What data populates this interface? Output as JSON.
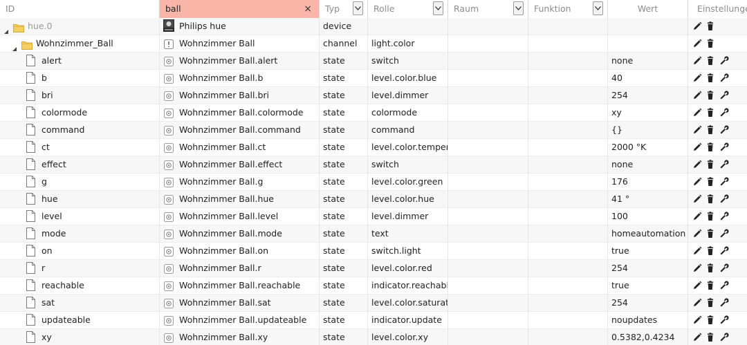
{
  "header": {
    "id_label": "ID",
    "name_filter_value": "ball",
    "typ_label": "Typ",
    "rolle_label": "Rolle",
    "raum_label": "Raum",
    "funktion_label": "Funktion",
    "wert_label": "Wert",
    "settings_label": "Einstellungen",
    "clear_icon": "×"
  },
  "colors": {
    "filter_bg": "#f9b5a8",
    "folder": "#f0c24b",
    "row_alt": "#f7f7f7"
  },
  "rows": [
    {
      "id": "hue.0",
      "name": "Philips hue",
      "typ": "device",
      "rolle": "",
      "wert": "",
      "level": 0,
      "kind": "adapter",
      "icon": "philips-hue-image",
      "actions": [
        "edit",
        "delete"
      ]
    },
    {
      "id": "Wohnzimmer_Ball",
      "name": "Wohnzimmer Ball",
      "typ": "channel",
      "rolle": "light.color",
      "wert": "",
      "level": 1,
      "kind": "folder",
      "icon": "channel-icon",
      "actions": [
        "edit",
        "delete"
      ]
    },
    {
      "id": "alert",
      "name": "Wohnzimmer Ball.alert",
      "typ": "state",
      "rolle": "switch",
      "wert": "none",
      "level": 2,
      "kind": "file",
      "icon": "state-icon",
      "actions": [
        "edit",
        "delete",
        "settings"
      ]
    },
    {
      "id": "b",
      "name": "Wohnzimmer Ball.b",
      "typ": "state",
      "rolle": "level.color.blue",
      "wert": "40",
      "level": 2,
      "kind": "file",
      "icon": "state-icon",
      "actions": [
        "edit",
        "delete",
        "settings"
      ]
    },
    {
      "id": "bri",
      "name": "Wohnzimmer Ball.bri",
      "typ": "state",
      "rolle": "level.dimmer",
      "wert": "254",
      "level": 2,
      "kind": "file",
      "icon": "state-icon",
      "actions": [
        "edit",
        "delete",
        "settings"
      ]
    },
    {
      "id": "colormode",
      "name": "Wohnzimmer Ball.colormode",
      "typ": "state",
      "rolle": "colormode",
      "wert": "xy",
      "level": 2,
      "kind": "file",
      "icon": "state-icon",
      "actions": [
        "edit",
        "delete",
        "settings"
      ]
    },
    {
      "id": "command",
      "name": "Wohnzimmer Ball.command",
      "typ": "state",
      "rolle": "command",
      "wert": "{}",
      "level": 2,
      "kind": "file",
      "icon": "state-icon",
      "actions": [
        "edit",
        "delete",
        "settings"
      ]
    },
    {
      "id": "ct",
      "name": "Wohnzimmer Ball.ct",
      "typ": "state",
      "rolle": "level.color.tempera",
      "wert": "2000 °K",
      "level": 2,
      "kind": "file",
      "icon": "state-icon",
      "actions": [
        "edit",
        "delete",
        "settings"
      ]
    },
    {
      "id": "effect",
      "name": "Wohnzimmer Ball.effect",
      "typ": "state",
      "rolle": "switch",
      "wert": "none",
      "level": 2,
      "kind": "file",
      "icon": "state-icon",
      "actions": [
        "edit",
        "delete",
        "settings"
      ]
    },
    {
      "id": "g",
      "name": "Wohnzimmer Ball.g",
      "typ": "state",
      "rolle": "level.color.green",
      "wert": "176",
      "level": 2,
      "kind": "file",
      "icon": "state-icon",
      "actions": [
        "edit",
        "delete",
        "settings"
      ]
    },
    {
      "id": "hue",
      "name": "Wohnzimmer Ball.hue",
      "typ": "state",
      "rolle": "level.color.hue",
      "wert": "41 °",
      "level": 2,
      "kind": "file",
      "icon": "state-icon",
      "actions": [
        "edit",
        "delete",
        "settings"
      ]
    },
    {
      "id": "level",
      "name": "Wohnzimmer Ball.level",
      "typ": "state",
      "rolle": "level.dimmer",
      "wert": "100",
      "level": 2,
      "kind": "file",
      "icon": "state-icon",
      "actions": [
        "edit",
        "delete",
        "settings"
      ]
    },
    {
      "id": "mode",
      "name": "Wohnzimmer Ball.mode",
      "typ": "state",
      "rolle": "text",
      "wert": "homeautomation",
      "level": 2,
      "kind": "file",
      "icon": "state-icon",
      "actions": [
        "edit",
        "delete",
        "settings"
      ]
    },
    {
      "id": "on",
      "name": "Wohnzimmer Ball.on",
      "typ": "state",
      "rolle": "switch.light",
      "wert": "true",
      "level": 2,
      "kind": "file",
      "icon": "state-icon",
      "actions": [
        "edit",
        "delete",
        "settings"
      ]
    },
    {
      "id": "r",
      "name": "Wohnzimmer Ball.r",
      "typ": "state",
      "rolle": "level.color.red",
      "wert": "254",
      "level": 2,
      "kind": "file",
      "icon": "state-icon",
      "actions": [
        "edit",
        "delete",
        "settings"
      ]
    },
    {
      "id": "reachable",
      "name": "Wohnzimmer Ball.reachable",
      "typ": "state",
      "rolle": "indicator.reachable",
      "wert": "true",
      "level": 2,
      "kind": "file",
      "icon": "state-icon",
      "actions": [
        "edit",
        "delete",
        "settings"
      ]
    },
    {
      "id": "sat",
      "name": "Wohnzimmer Ball.sat",
      "typ": "state",
      "rolle": "level.color.saturatic",
      "wert": "254",
      "level": 2,
      "kind": "file",
      "icon": "state-icon",
      "actions": [
        "edit",
        "delete",
        "settings"
      ]
    },
    {
      "id": "updateable",
      "name": "Wohnzimmer Ball.updateable",
      "typ": "state",
      "rolle": "indicator.update",
      "wert": "noupdates",
      "level": 2,
      "kind": "file",
      "icon": "state-icon",
      "actions": [
        "edit",
        "delete",
        "settings"
      ]
    },
    {
      "id": "xy",
      "name": "Wohnzimmer Ball.xy",
      "typ": "state",
      "rolle": "level.color.xy",
      "wert": "0.5382,0.4234",
      "level": 2,
      "kind": "file",
      "icon": "state-icon",
      "actions": [
        "edit",
        "delete",
        "settings"
      ]
    }
  ]
}
